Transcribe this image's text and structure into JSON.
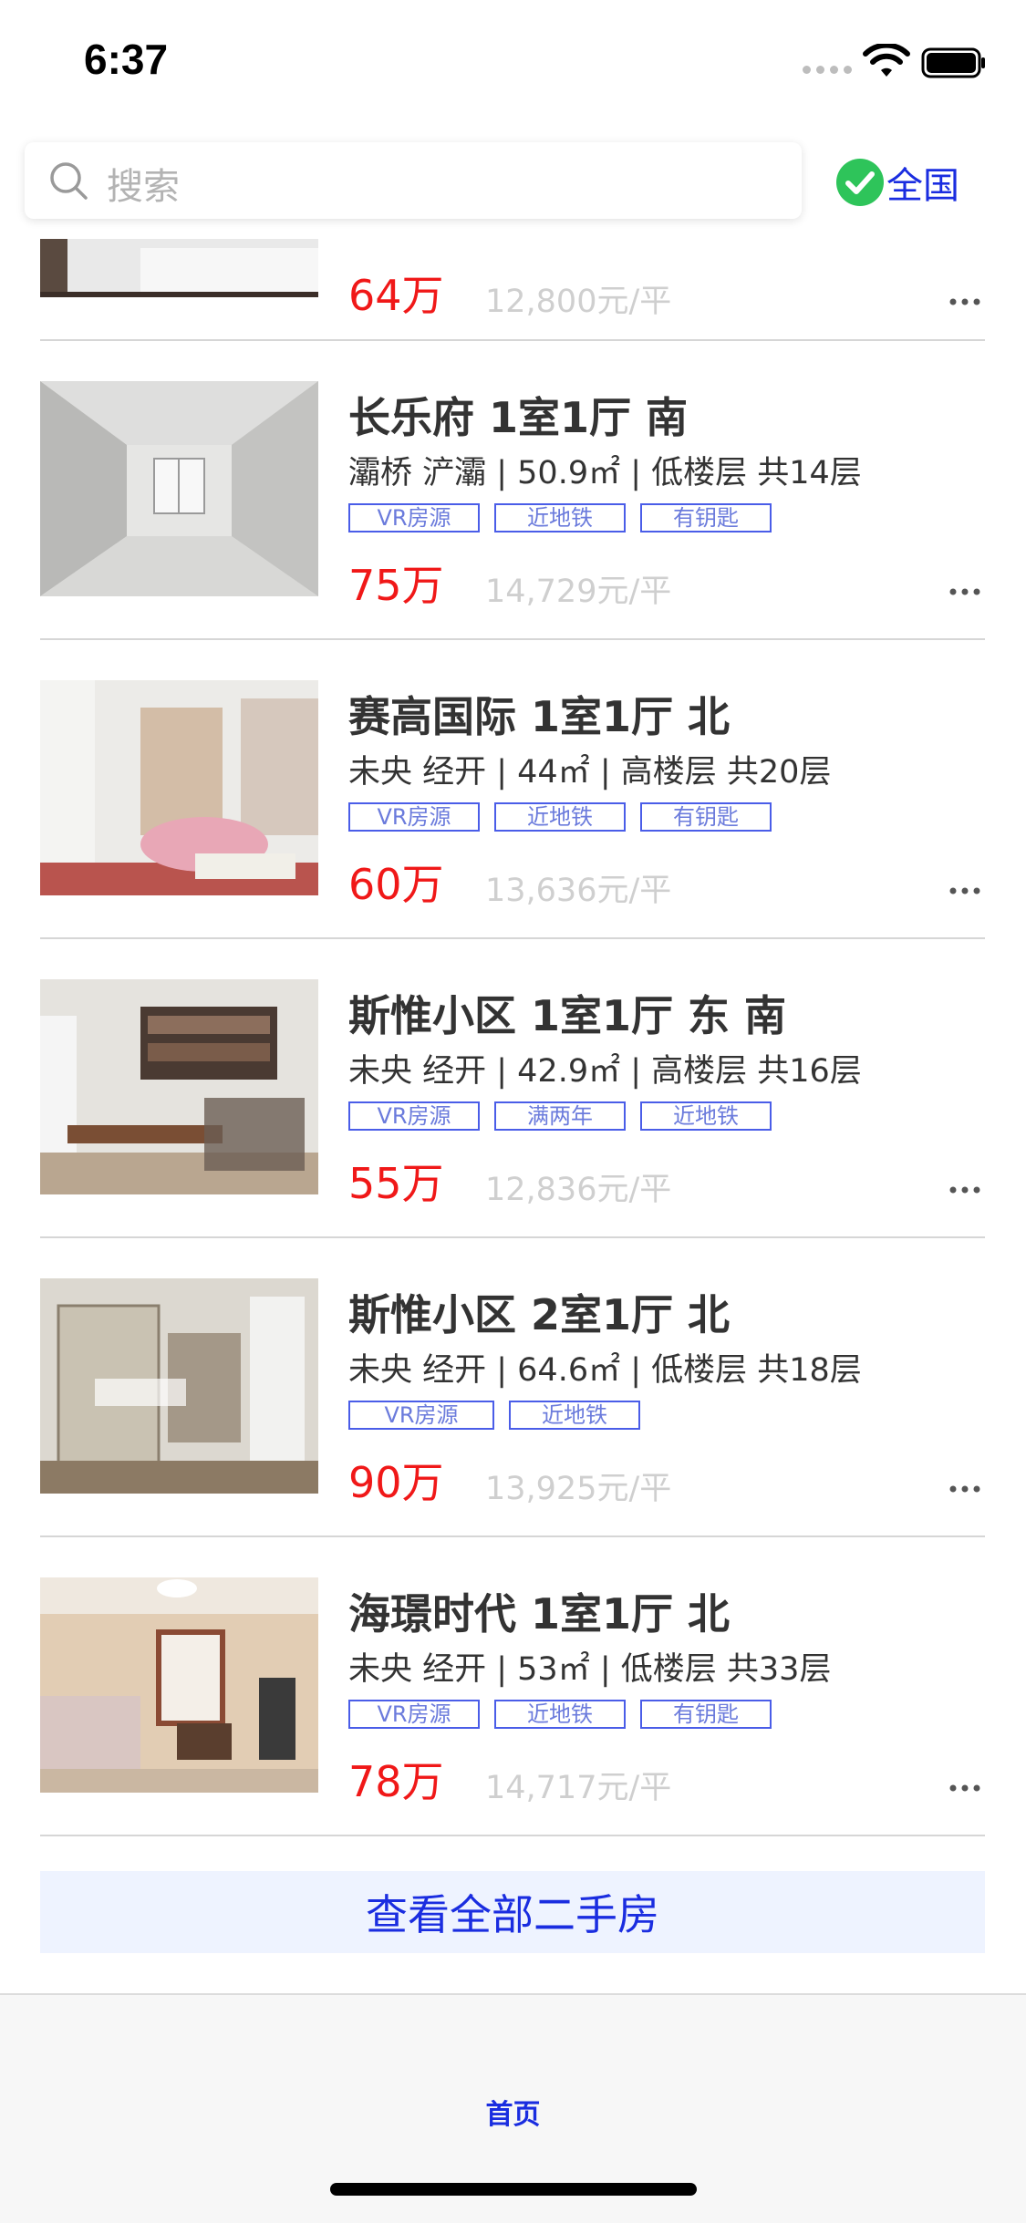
{
  "status_bar": {
    "time": "6:37"
  },
  "search": {
    "placeholder": "搜索"
  },
  "region": {
    "label": "全国"
  },
  "listings_partial": {
    "price": "64万",
    "unit_price": "12,800元/平"
  },
  "listings": [
    {
      "title": "长乐府 1室1厅 南",
      "subtitle": "灞桥 浐灞 | 50.9㎡ | 低楼层 共14层",
      "tags": [
        "VR房源",
        "近地铁",
        "有钥匙"
      ],
      "price": "75万",
      "unit_price": "14,729元/平"
    },
    {
      "title": "赛高国际 1室1厅 北",
      "subtitle": "未央 经开 | 44㎡ | 高楼层 共20层",
      "tags": [
        "VR房源",
        "近地铁",
        "有钥匙"
      ],
      "price": "60万",
      "unit_price": "13,636元/平"
    },
    {
      "title": "斯惟小区 1室1厅 东 南",
      "subtitle": "未央 经开 | 42.9㎡ | 高楼层 共16层",
      "tags": [
        "VR房源",
        "满两年",
        "近地铁"
      ],
      "price": "55万",
      "unit_price": "12,836元/平"
    },
    {
      "title": "斯惟小区 2室1厅 北",
      "subtitle": "未央 经开 | 64.6㎡ | 低楼层 共18层",
      "tags": [
        "VR房源",
        "近地铁"
      ],
      "price": "90万",
      "unit_price": "13,925元/平"
    },
    {
      "title": "海璟时代 1室1厅 北",
      "subtitle": "未央 经开 | 53㎡ | 低楼层 共33层",
      "tags": [
        "VR房源",
        "近地铁",
        "有钥匙"
      ],
      "price": "78万",
      "unit_price": "14,717元/平"
    }
  ],
  "view_all": {
    "label": "查看全部二手房"
  },
  "tab_bar": {
    "home_label": "首页"
  },
  "colors": {
    "accent": "#1a2de0",
    "price": "#f01818",
    "tag_border": "#4a5de8",
    "check": "#2ec45a"
  }
}
